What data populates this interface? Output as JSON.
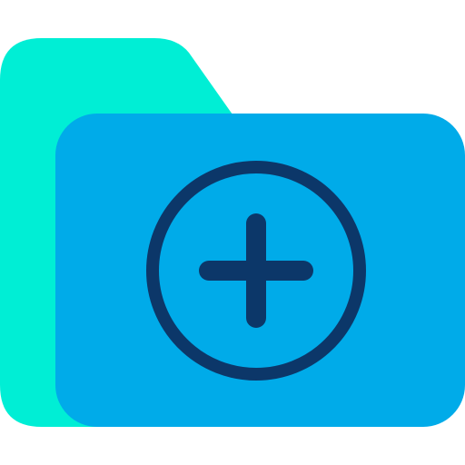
{
  "icon": {
    "name": "folder-add-icon",
    "colors": {
      "folder_back": "#00EED5",
      "folder_front": "#00ABE9",
      "plus_stroke": "#0C3769",
      "background": "#FFFFFF"
    }
  }
}
